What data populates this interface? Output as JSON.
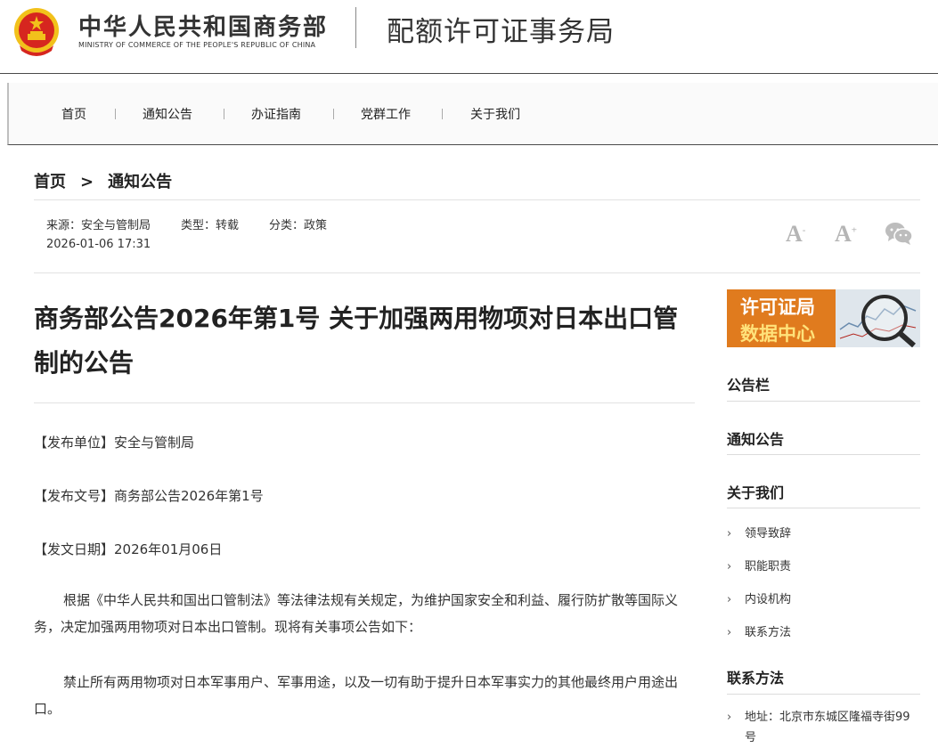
{
  "header": {
    "ministry_cn": "中华人民共和国商务部",
    "ministry_en": "MINISTRY OF COMMERCE OF THE PEOPLE'S REPUBLIC OF CHINA",
    "bureau": "配额许可证事务局"
  },
  "nav": [
    "首页",
    "通知公告",
    "办证指南",
    "党群工作",
    "关于我们"
  ],
  "breadcrumb": {
    "home": "首页",
    "sep": ">",
    "current": "通知公告"
  },
  "meta": {
    "source": "来源：安全与管制局",
    "type": "类型：转载",
    "category": "分类：政策",
    "datetime": "2026-01-06 17:31"
  },
  "tools": {
    "font_smaller": "A",
    "font_larger": "A",
    "smaller_mark": "-",
    "larger_mark": "+",
    "share_icon": "wechat-icon"
  },
  "article": {
    "title": "商务部公告2026年第1号 关于加强两用物项对日本出口管制的公告",
    "fields": [
      "【发布单位】安全与管制局",
      "【发布文号】商务部公告2026年第1号",
      "【发文日期】2026年01月06日"
    ],
    "paragraphs": [
      "根据《中华人民共和国出口管制法》等法律法规有关规定，为维护国家安全和利益、履行防扩散等国际义务，决定加强两用物项对日本出口管制。现将有关事项公告如下：",
      "禁止所有两用物项对日本军事用户、军事用途，以及一切有助于提升日本军事实力的其他最终用户用途出口。"
    ]
  },
  "sidebar": {
    "banner_line1": "许可证局",
    "banner_line2": "数据中心",
    "sections": [
      "公告栏",
      "通知公告",
      "关于我们"
    ],
    "about_links": [
      "领导致辞",
      "职能职责",
      "内设机构",
      "联系方法"
    ],
    "contact_title": "联系方法",
    "address": "地址：北京市东城区隆福寺街99号"
  },
  "colors": {
    "banner_orange": "#e07b1e",
    "banner_yellow": "#ffe27a",
    "emblem_red": "#d6261f",
    "emblem_gold": "#f2c11b"
  }
}
